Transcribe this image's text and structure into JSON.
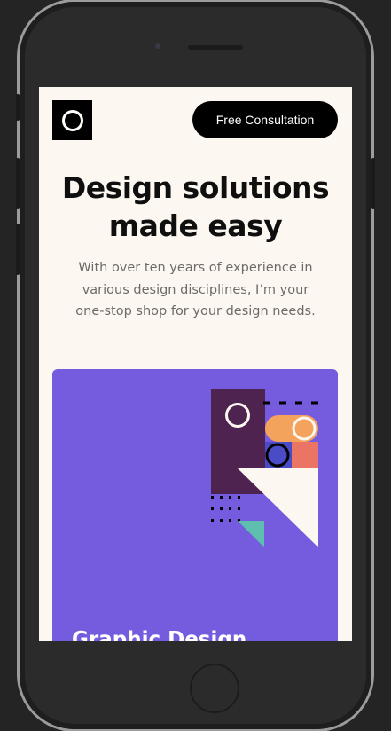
{
  "header": {
    "logo_icon": "ring-icon",
    "cta_label": "Free Consultation"
  },
  "hero": {
    "title": "Design solutions made easy",
    "subtitle": "With over ten years of experience in various design disciplines, I’m your one-stop shop for your design needs."
  },
  "card": {
    "title": "Graphic Design",
    "colors": {
      "background": "#755cde",
      "plum": "#4f2350",
      "orange": "#f3a35c",
      "coral": "#eb7565",
      "teal": "#5ebfb1",
      "cream": "#fdf7f1"
    }
  },
  "device": {
    "frame_color": "#2b2b2b",
    "page_background": "#242424"
  }
}
